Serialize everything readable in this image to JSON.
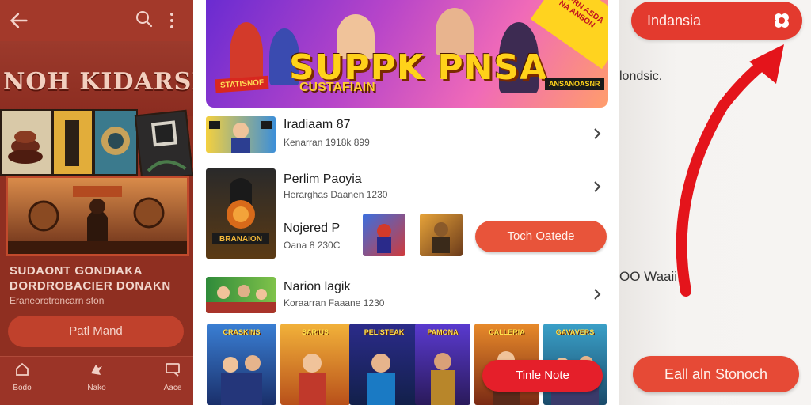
{
  "left_panel": {
    "hero_title": "NOH KIDARSIA",
    "subtitle_line1": "SUDAONT GONDIAKA",
    "subtitle_line2": "DORDROBACIER DONAKN",
    "subtitle_line3": "Eraneorotroncarn ston",
    "button_label": "Patl Mand",
    "bottom_nav": [
      {
        "label": "Bodo",
        "icon": "home-icon"
      },
      {
        "label": "Nako",
        "icon": "bird-icon"
      },
      {
        "label": "Aace",
        "icon": "chat-icon"
      }
    ]
  },
  "center_panel": {
    "banner": {
      "title": "SUPPK PNSA",
      "subtitle": "CUSTAFIAIN",
      "tag_left": "STATISNOF",
      "tag_right": "ANSANOASNR",
      "corner_text": "SPRN ASDA NA ANSON"
    },
    "rows": [
      {
        "name": "Iradiaam 87",
        "meta": "Kenarran 1918k 899"
      },
      {
        "name": "Perlim Paoyia",
        "meta": "Herarghas Daanen 1230"
      },
      {
        "name": "Nojered P",
        "meta": "Oana 8 230C"
      },
      {
        "name": "Narion lagik",
        "meta": "Koraarran Faaane 1230"
      }
    ],
    "poster_label": "BRANAION",
    "orange_button": "Toch Oatede",
    "red_button": "Tinle Note",
    "game_cards": [
      {
        "label": "CRASKINS"
      },
      {
        "label": "SARIUS"
      },
      {
        "label": "PELISTEAK"
      },
      {
        "label": "PAMONA"
      },
      {
        "label": "CALLERIA"
      },
      {
        "label": "GAVAVERS"
      }
    ],
    "colors": {
      "accent_orange": "#e8543a",
      "accent_red": "#e51f2a"
    }
  },
  "right_panel": {
    "pill_label": "Indansia",
    "text_1": "londsic.",
    "text_2": "OO Waaii",
    "bottom_button": "Eall aln Stonoch",
    "arrow_color": "#e4141b"
  }
}
